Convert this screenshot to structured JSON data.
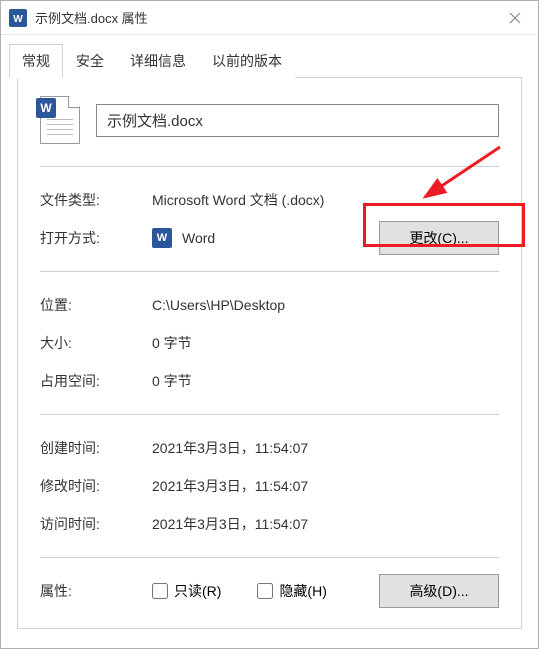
{
  "titlebar": {
    "title": "示例文档.docx 属性"
  },
  "tabs": {
    "general": "常规",
    "security": "安全",
    "details": "详细信息",
    "previous": "以前的版本"
  },
  "filename": "示例文档.docx",
  "labels": {
    "filetype": "文件类型:",
    "openwith": "打开方式:",
    "location": "位置:",
    "size": "大小:",
    "sizeondisk": "占用空间:",
    "created": "创建时间:",
    "modified": "修改时间:",
    "accessed": "访问时间:",
    "attributes": "属性:"
  },
  "values": {
    "filetype": "Microsoft Word 文档 (.docx)",
    "openwith": "Word",
    "location": "C:\\Users\\HP\\Desktop",
    "size": "0 字节",
    "sizeondisk": "0 字节",
    "created": "2021年3月3日，11:54:07",
    "modified": "2021年3月3日，11:54:07",
    "accessed": "2021年3月3日，11:54:07"
  },
  "buttons": {
    "change": "更改(C)...",
    "advanced": "高级(D)..."
  },
  "checkboxes": {
    "readonly": "只读(R)",
    "hidden": "隐藏(H)"
  }
}
